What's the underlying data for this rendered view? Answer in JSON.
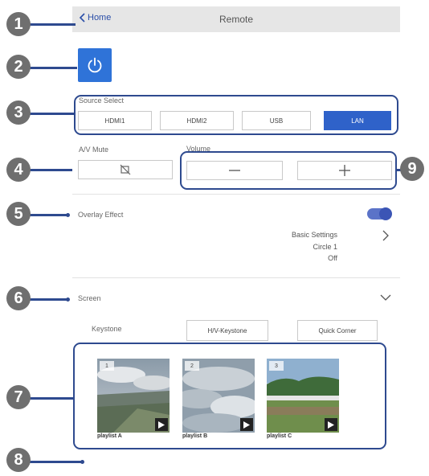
{
  "header": {
    "back_label": "Home",
    "title": "Remote"
  },
  "power": {
    "icon": "power-icon",
    "color": "#2f73d8"
  },
  "source_select": {
    "label": "Source Select",
    "options": [
      "HDMI1",
      "HDMI2",
      "USB",
      "LAN"
    ],
    "selected": "LAN",
    "accent": "#2f62c9"
  },
  "av_mute": {
    "label": "A/V Mute",
    "icon": "av-mute-icon"
  },
  "volume": {
    "label": "Volume",
    "decrease_icon": "minus-icon",
    "increase_icon": "plus-icon"
  },
  "overlay": {
    "label": "Overlay Effect",
    "enabled": true,
    "settings_title": "Basic Settings",
    "settings_value": "Circle 1",
    "settings_state": "Off",
    "toggle_color": "#3b55b5"
  },
  "screen": {
    "label": "Screen",
    "keystone_label": "Keystone",
    "hv_keystone_label": "H/V-Keystone",
    "quick_corner_label": "Quick Corner"
  },
  "playlists": [
    {
      "number": "1",
      "name": "playlist A"
    },
    {
      "number": "2",
      "name": "playlist B"
    },
    {
      "number": "3",
      "name": "playlist C"
    }
  ],
  "callouts": [
    "1",
    "2",
    "3",
    "4",
    "5",
    "6",
    "7",
    "8",
    "9"
  ],
  "highlight_color": "#2e4a8f"
}
